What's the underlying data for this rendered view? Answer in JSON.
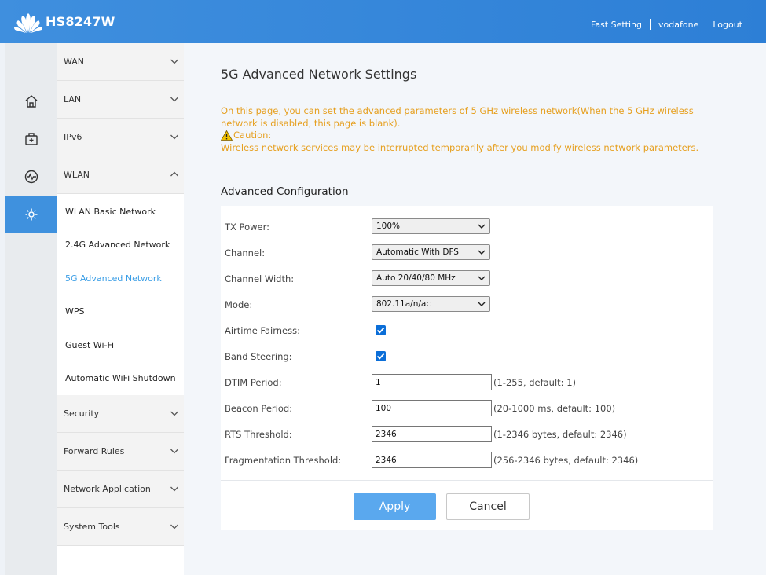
{
  "header": {
    "model": "HS8247W",
    "links": [
      "Fast Setting",
      "vodafone",
      "Logout"
    ]
  },
  "rail": {
    "items": [
      "home-icon",
      "add-device-icon",
      "pulse-icon",
      "gear-icon"
    ],
    "active": "gear-icon"
  },
  "menu": {
    "wan": "WAN",
    "lan": "LAN",
    "ipv6": "IPv6",
    "wlan": "WLAN",
    "wlan_items": [
      "WLAN Basic Network",
      "2.4G Advanced Network",
      "5G Advanced Network",
      "WPS",
      "Guest Wi-Fi",
      "Automatic WiFi Shutdown"
    ],
    "security": "Security",
    "forward_rules": "Forward Rules",
    "network_application": "Network Application",
    "system_tools": "System Tools"
  },
  "page": {
    "title": "5G Advanced Network Settings",
    "note_line": "On this page, you can set the advanced parameters of 5 GHz wireless network(When the 5 GHz wireless network is disabled, this page is blank).",
    "caution_label": "Caution:",
    "caution_text": "Wireless network services may be interrupted temporarily after you modify wireless network parameters.",
    "section": "Advanced Configuration"
  },
  "form": {
    "tx_power": {
      "label": "TX Power:",
      "value": "100%"
    },
    "channel": {
      "label": "Channel:",
      "value": "Automatic With DFS"
    },
    "channel_width": {
      "label": "Channel Width:",
      "value": "Auto 20/40/80 MHz"
    },
    "mode": {
      "label": "Mode:",
      "value": "802.11a/n/ac"
    },
    "airtime_fairness": {
      "label": "Airtime Fairness:",
      "checked": true
    },
    "band_steering": {
      "label": "Band Steering:",
      "checked": true
    },
    "dtim_period": {
      "label": "DTIM Period:",
      "value": "1",
      "hint": "(1-255, default: 1)"
    },
    "beacon_period": {
      "label": "Beacon Period:",
      "value": "100",
      "hint": "(20-1000 ms, default: 100)"
    },
    "rts_threshold": {
      "label": "RTS Threshold:",
      "value": "2346",
      "hint": "(1-2346 bytes, default: 2346)"
    },
    "fragmentation_threshold": {
      "label": "Fragmentation Threshold:",
      "value": "2346",
      "hint": "(256-2346 bytes, default: 2346)"
    }
  },
  "buttons": {
    "apply": "Apply",
    "cancel": "Cancel"
  },
  "colors": {
    "header_blue": "#3f8fde",
    "accent_blue": "#3f91de",
    "note_orange": "#e6a020",
    "apply_blue": "#5aa8ee",
    "current_link": "#3b9ee6"
  }
}
